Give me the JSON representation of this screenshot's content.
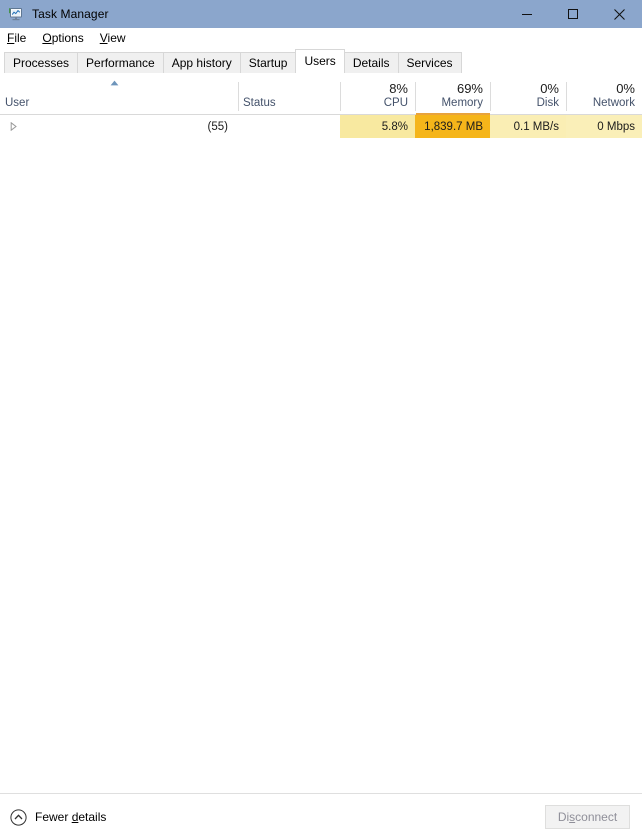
{
  "window": {
    "title": "Task Manager",
    "icon": "task-manager-monitor-chart-icon",
    "titlebar_color": "#8ba6cc",
    "controls": {
      "minimize": "minimize-icon",
      "maximize": "maximize-icon",
      "close": "close-icon"
    }
  },
  "menubar": {
    "items": [
      {
        "label": "File",
        "accel": "F"
      },
      {
        "label": "Options",
        "accel": "O"
      },
      {
        "label": "View",
        "accel": "V"
      }
    ]
  },
  "tabs": {
    "active": "Users",
    "items": [
      {
        "label": "Processes"
      },
      {
        "label": "Performance"
      },
      {
        "label": "App history"
      },
      {
        "label": "Startup"
      },
      {
        "label": "Users"
      },
      {
        "label": "Details"
      },
      {
        "label": "Services"
      }
    ]
  },
  "table": {
    "sort_column": "User",
    "sort_direction": "ascending",
    "highlight_column": "Memory",
    "columns": [
      {
        "key": "user",
        "label": "User",
        "value": "",
        "align": "left"
      },
      {
        "key": "status",
        "label": "Status",
        "value": "",
        "align": "left"
      },
      {
        "key": "cpu",
        "label": "CPU",
        "value": "8%",
        "align": "right"
      },
      {
        "key": "memory",
        "label": "Memory",
        "value": "69%",
        "align": "right"
      },
      {
        "key": "disk",
        "label": "Disk",
        "value": "0%",
        "align": "right"
      },
      {
        "key": "network",
        "label": "Network",
        "value": "0%",
        "align": "right"
      }
    ],
    "rows": [
      {
        "expander": "expand-triangle-icon",
        "expanded": false,
        "user": "",
        "process_count": "(55)",
        "status": "",
        "cpu": "5.8%",
        "memory": "1,839.7 MB",
        "disk": "0.1 MB/s",
        "network": "0 Mbps"
      }
    ],
    "heat_colors": {
      "cpu": "#f8e9a0",
      "memory": "#f5b51a",
      "disk": "#faeeb4",
      "network": "#faefb8"
    }
  },
  "footer": {
    "fewer_details": {
      "label": "Fewer details",
      "accel": "d",
      "icon": "chevron-up-circle-icon"
    },
    "disconnect": {
      "label": "Disconnect",
      "accel": "s",
      "enabled": false
    }
  }
}
